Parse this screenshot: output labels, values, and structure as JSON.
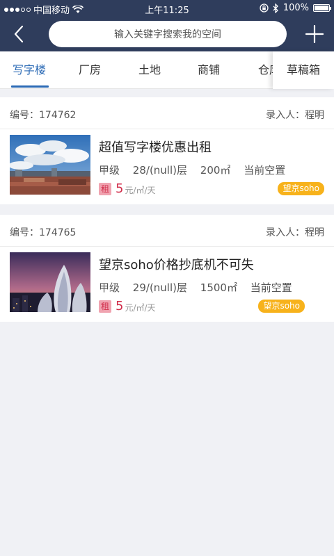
{
  "status_bar": {
    "carrier": "中国移动",
    "time": "上午11:25",
    "battery": "100%"
  },
  "nav": {
    "search_placeholder": "输入关键字搜索我的空间"
  },
  "tabs": [
    "写字楼",
    "厂房",
    "土地",
    "商铺",
    "仓库"
  ],
  "active_tab": "写字楼",
  "drafts_label": "草稿箱",
  "listings": [
    {
      "code": "编号：174762",
      "entry": "录入人：程明",
      "title": "超值写字楼优惠出租",
      "grade": "甲级",
      "floor": "28/(null)层",
      "area": "200㎡",
      "status": "当前空置",
      "rent_badge": "租",
      "price": "5",
      "unit": "元/㎡/天",
      "tag": "望京soho"
    },
    {
      "code": "编号：174765",
      "entry": "录入人：程明",
      "title": "望京soho价格抄底机不可失",
      "grade": "甲级",
      "floor": "29/(null)层",
      "area": "1500㎡",
      "status": "当前空置",
      "rent_badge": "租",
      "price": "5",
      "unit": "元/㎡/天",
      "tag": "望京soho"
    }
  ],
  "colors": {
    "header_bg": "#2f3d5c",
    "accent": "#2b6ab5",
    "price": "#d12e4b",
    "tag_bg": "#f7b21b"
  }
}
